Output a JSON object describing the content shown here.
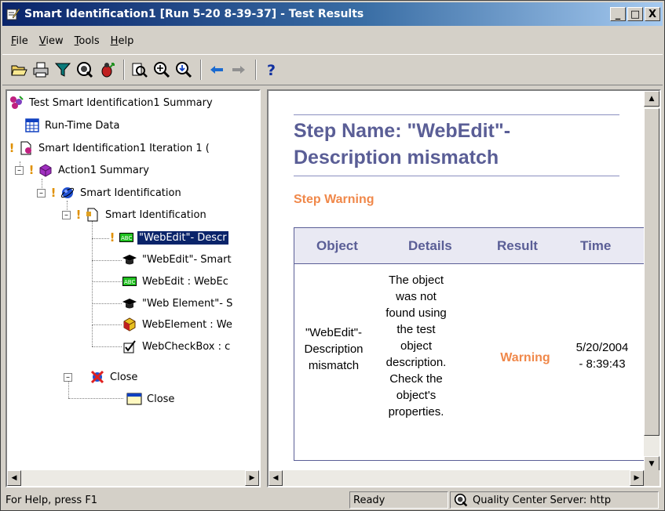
{
  "window": {
    "title": "Smart Identification1 [Run 5-20 8-39-37] - Test Results",
    "buttons": [
      "_",
      "□",
      "X"
    ]
  },
  "menu": [
    {
      "label": "File",
      "key": "F",
      "rest": "ile"
    },
    {
      "label": "View",
      "key": "V",
      "rest": "iew"
    },
    {
      "label": "Tools",
      "key": "T",
      "rest": "ools"
    },
    {
      "label": "Help",
      "key": "H",
      "rest": "elp"
    }
  ],
  "toolbar": {
    "icons": [
      "open-icon",
      "print-icon",
      "filter-icon",
      "quality-center-icon",
      "defect-icon",
      "find-icon",
      "zoom-in-icon",
      "zoom-out-icon",
      "back-icon",
      "forward-icon",
      "help-icon"
    ]
  },
  "tree": {
    "nodes": [
      {
        "label": "Test Smart Identification1 Summary",
        "icon": "test-summary-icon"
      },
      {
        "label": "Run-Time Data",
        "icon": "data-table-icon"
      },
      {
        "label": "Smart Identification1 Iteration 1 (",
        "icon": "iteration-icon"
      },
      {
        "label": "Action1 Summary",
        "icon": "action-icon"
      },
      {
        "label": "Smart Identification",
        "icon": "globe-icon"
      },
      {
        "label": "Smart Identification",
        "icon": "page-icon"
      },
      {
        "label": "\"WebEdit\"- Descr",
        "icon": "webedit-icon"
      },
      {
        "label": "\"WebEdit\"- Smart",
        "icon": "grad-cap-icon"
      },
      {
        "label": "WebEdit : WebEc",
        "icon": "webedit-icon"
      },
      {
        "label": "\"Web Element\"- S",
        "icon": "grad-cap-icon"
      },
      {
        "label": "WebElement : We",
        "icon": "web-element-icon"
      },
      {
        "label": "WebCheckBox : c",
        "icon": "checkbox-icon"
      },
      {
        "label": "Close",
        "icon": "close-x-icon"
      },
      {
        "label": "Close",
        "icon": "window-icon"
      }
    ]
  },
  "details": {
    "step_name": "Step Name: \"WebEdit\"- Description mismatch",
    "step_status": "Step Warning",
    "table": {
      "headers": [
        "Object",
        "Details",
        "Result",
        "Time"
      ],
      "row": {
        "object": [
          "\"WebEdit\"-",
          "Description",
          "mismatch"
        ],
        "details": [
          "The object",
          "was not",
          "found using",
          "the test",
          "object",
          "description.",
          "Check the",
          "object's",
          "properties."
        ],
        "result": "Warning",
        "time": [
          "5/20/2004",
          "- 8:39:43"
        ]
      }
    }
  },
  "statusbar": {
    "help": "For Help, press F1",
    "state": "Ready",
    "server": "Quality Center Server: http"
  },
  "colors": {
    "title_gradient_start": "#0a246a",
    "heading": "#5a5e96",
    "warning": "#f0884a",
    "selection": "#0a246a"
  }
}
